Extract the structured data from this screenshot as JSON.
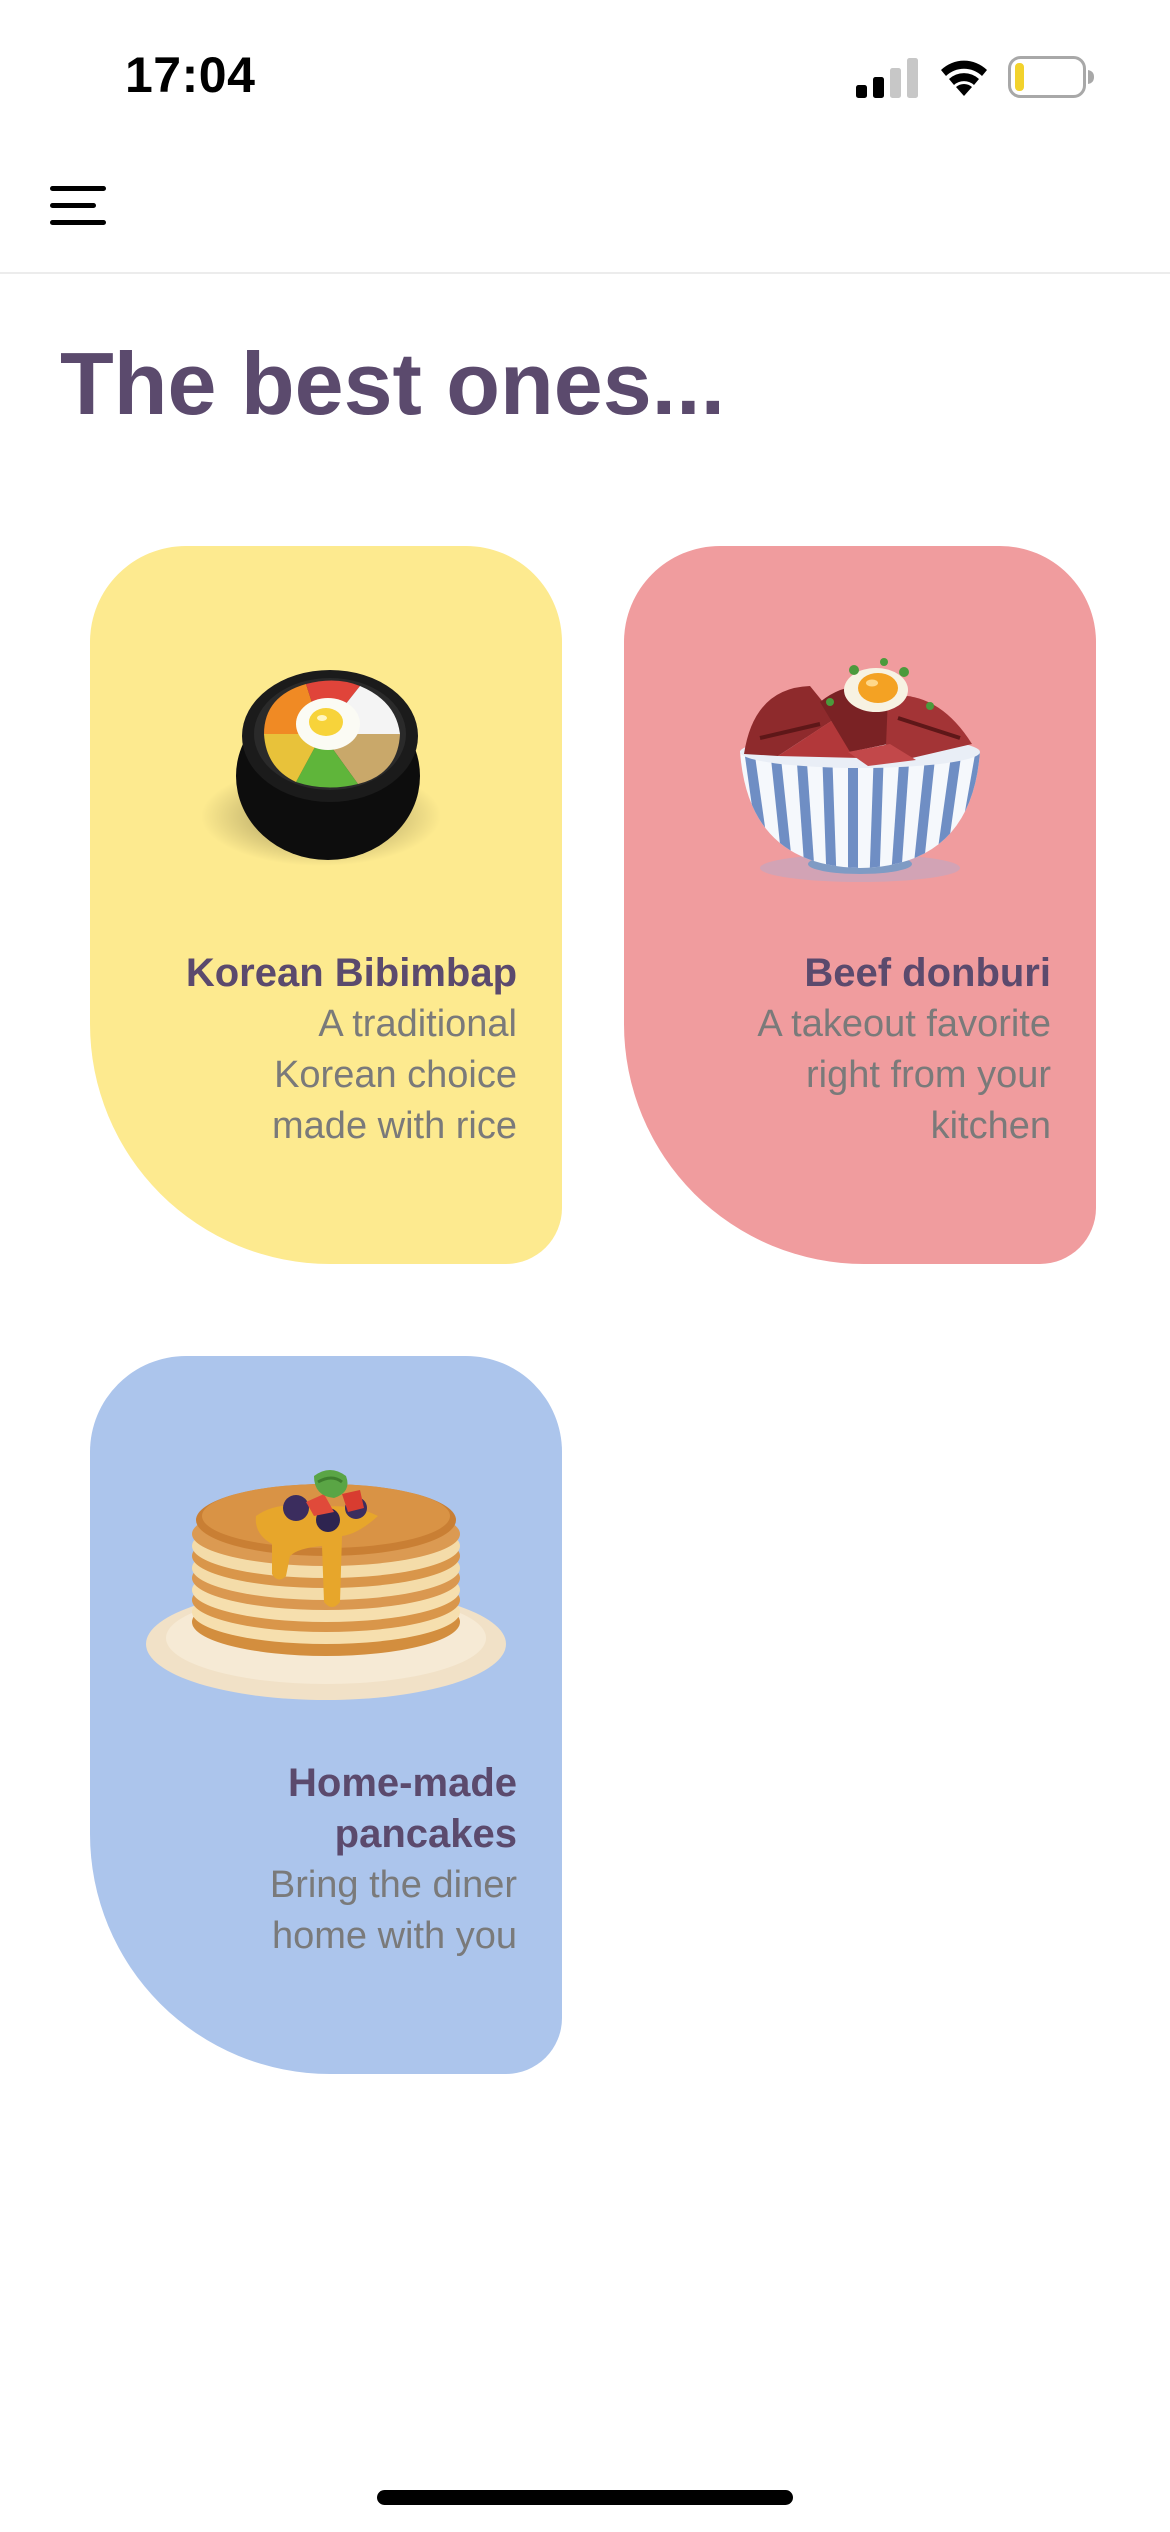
{
  "status_bar": {
    "time": "17:04",
    "icons": [
      "cellular-signal-icon",
      "wifi-icon",
      "battery-low-icon"
    ]
  },
  "nav": {
    "menu_icon": "hamburger-menu-icon"
  },
  "page": {
    "title": "The best ones..."
  },
  "colors": {
    "title": "#5b4a6d",
    "description": "#7a7a7a",
    "card_yellow": "#fdea8f",
    "card_pink": "#f09c9e",
    "card_blue": "#acc5ec",
    "battery_level": "#f2d22c"
  },
  "cards": [
    {
      "title": "Korean Bibimbap",
      "description": [
        "A traditional",
        "Korean choice",
        "made with rice"
      ],
      "image": "bibimbap-bowl-illustration",
      "color": "#fdea8f"
    },
    {
      "title": "Beef donburi",
      "description": [
        "A takeout favorite",
        "right from your",
        "kitchen"
      ],
      "image": "beef-donburi-bowl-illustration",
      "color": "#f09c9e"
    },
    {
      "title": "Home-made pancakes",
      "title_lines": [
        "Home-made",
        "pancakes"
      ],
      "description": [
        "Bring the diner",
        "home with you"
      ],
      "image": "pancake-stack-illustration",
      "color": "#acc5ec"
    }
  ]
}
